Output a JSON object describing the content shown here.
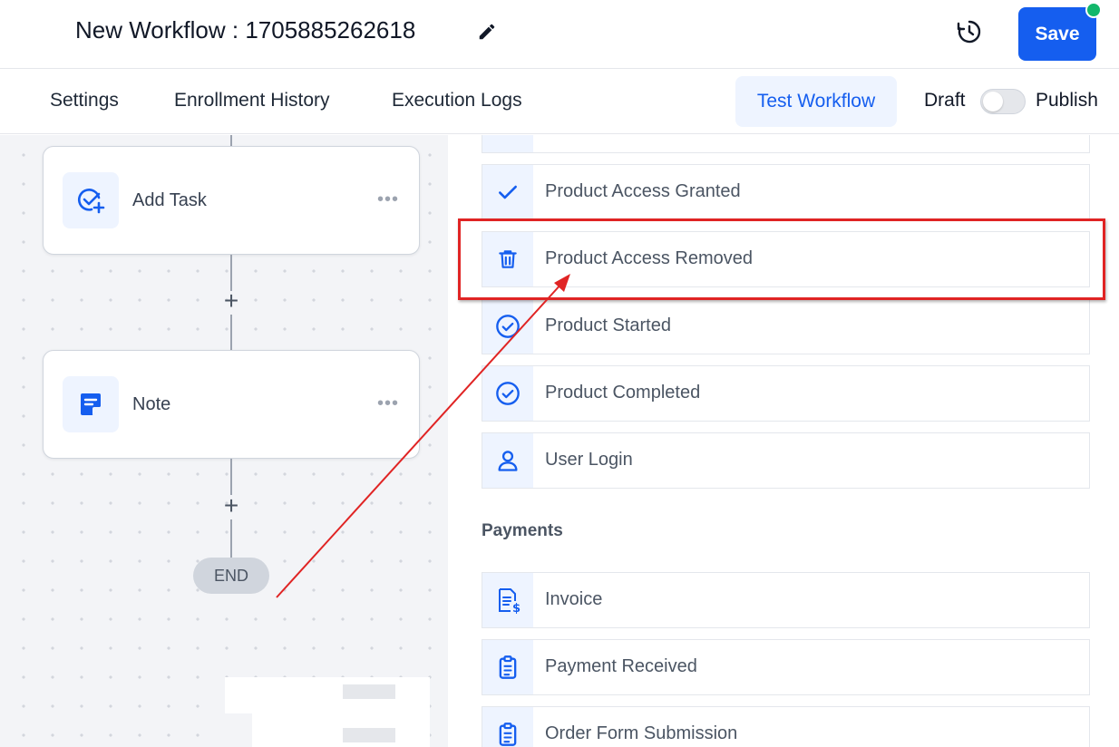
{
  "header": {
    "title": "New Workflow : 1705885262618",
    "save_label": "Save",
    "accent_color": "#155eef",
    "status_dot_color": "#12b76a"
  },
  "nav": {
    "tabs": [
      {
        "label": "Settings"
      },
      {
        "label": "Enrollment History"
      },
      {
        "label": "Execution Logs"
      }
    ],
    "test_workflow_label": "Test Workflow",
    "draft_label": "Draft",
    "publish_label": "Publish",
    "publish_toggle_on": false
  },
  "canvas": {
    "nodes": [
      {
        "label": "Add Task",
        "icon": "task-add-icon"
      },
      {
        "label": "Note",
        "icon": "note-icon"
      }
    ],
    "end_label": "END"
  },
  "panel": {
    "triggers": [
      {
        "label": "Product Access Granted",
        "icon": "check-icon"
      },
      {
        "label": "Product Access Removed",
        "icon": "trash-icon",
        "highlighted": true
      },
      {
        "label": "Product Started",
        "icon": "check-circle-icon"
      },
      {
        "label": "Product Completed",
        "icon": "check-circle-icon"
      },
      {
        "label": "User Login",
        "icon": "user-icon"
      }
    ],
    "payments_title": "Payments",
    "payments": [
      {
        "label": "Invoice",
        "icon": "invoice-icon"
      },
      {
        "label": "Payment Received",
        "icon": "clipboard-icon"
      },
      {
        "label": "Order Form Submission",
        "icon": "clipboard-icon"
      }
    ]
  }
}
